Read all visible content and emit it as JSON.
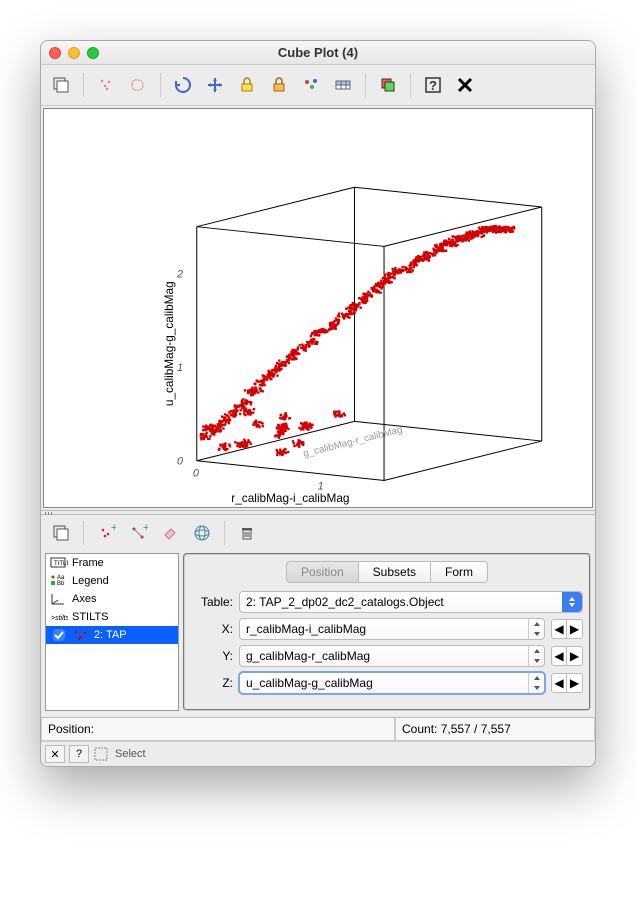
{
  "window": {
    "title": "Cube Plot (4)"
  },
  "toolbar_icons": {
    "export": "export-icon",
    "draw": "draw-subset-icon",
    "blob": "blob-subset-icon",
    "rescale": "rescale-icon",
    "move": "move-icon",
    "lock1": "lock-icon",
    "lock2": "lock2-icon",
    "sketch": "sketch-icon",
    "grid": "grid-icon",
    "layer": "add-layer-icon",
    "help": "help-icon",
    "close": "close-icon"
  },
  "tree": {
    "items": [
      {
        "label": "Frame"
      },
      {
        "label": "Legend"
      },
      {
        "label": "Axes"
      },
      {
        "label": "STILTS"
      },
      {
        "label": "2: TAP",
        "selected": true
      }
    ]
  },
  "tabs": {
    "t0": "Position",
    "t1": "Subsets",
    "t2": "Form",
    "active": 0
  },
  "form": {
    "table_label": "Table:",
    "table_value": "2: TAP_2_dp02_dc2_catalogs.Object",
    "x_label": "X:",
    "x_value": "r_calibMag-i_calibMag",
    "y_label": "Y:",
    "y_value": "g_calibMag-r_calibMag",
    "z_label": "Z:",
    "z_value": "u_calibMag-g_calibMag"
  },
  "status": {
    "position_label": "Position:",
    "count_label": "Count: 7,557 / 7,557"
  },
  "footer": {
    "select_label": "Select"
  },
  "chart_data": {
    "type": "scatter",
    "title": "",
    "axis_labels": {
      "x": "r_calibMag-i_calibMag",
      "y": "g_calibMag-r_calibMag",
      "z": "u_calibMag-g_calibMag"
    },
    "x_range": [
      0,
      1.5
    ],
    "y_range": [
      0,
      1.5
    ],
    "z_range": [
      0,
      2.5
    ],
    "x_ticks": [
      0,
      1
    ],
    "z_ticks": [
      0,
      1,
      2
    ],
    "series": [
      {
        "name": "2: TAP_2_dp02_dc2_catalogs.Object",
        "color": "#d40000",
        "n_points": 7557,
        "note": "dense S-shaped stellar locus from (~0.1, ~0.0, ~0.3) to (~1.4, ~1.3, ~2.3); points below are subsampled"
      }
    ],
    "sample_points_xyz": [
      [
        0.02,
        0.05,
        0.25
      ],
      [
        0.05,
        0.05,
        0.35
      ],
      [
        0.08,
        0.08,
        0.3
      ],
      [
        0.1,
        0.1,
        0.35
      ],
      [
        0.12,
        0.1,
        0.4
      ],
      [
        0.15,
        0.12,
        0.45
      ],
      [
        0.18,
        0.15,
        0.5
      ],
      [
        0.2,
        0.18,
        0.55
      ],
      [
        0.23,
        0.2,
        0.6
      ],
      [
        0.25,
        0.22,
        0.7
      ],
      [
        0.27,
        0.25,
        0.72
      ],
      [
        0.3,
        0.25,
        0.8
      ],
      [
        0.32,
        0.3,
        0.85
      ],
      [
        0.35,
        0.3,
        0.9
      ],
      [
        0.38,
        0.32,
        0.95
      ],
      [
        0.4,
        0.35,
        1.0
      ],
      [
        0.42,
        0.4,
        1.05
      ],
      [
        0.45,
        0.4,
        1.1
      ],
      [
        0.48,
        0.45,
        1.15
      ],
      [
        0.5,
        0.5,
        1.2
      ],
      [
        0.53,
        0.5,
        1.3
      ],
      [
        0.55,
        0.55,
        1.3
      ],
      [
        0.58,
        0.6,
        1.35
      ],
      [
        0.6,
        0.6,
        1.4
      ],
      [
        0.63,
        0.65,
        1.45
      ],
      [
        0.65,
        0.7,
        1.5
      ],
      [
        0.68,
        0.7,
        1.55
      ],
      [
        0.7,
        0.75,
        1.6
      ],
      [
        0.73,
        0.75,
        1.65
      ],
      [
        0.75,
        0.8,
        1.7
      ],
      [
        0.78,
        0.8,
        1.75
      ],
      [
        0.8,
        0.85,
        1.8
      ],
      [
        0.83,
        0.85,
        1.85
      ],
      [
        0.85,
        0.9,
        1.9
      ],
      [
        0.88,
        0.95,
        1.9
      ],
      [
        0.9,
        1.0,
        1.95
      ],
      [
        0.93,
        1.0,
        2.0
      ],
      [
        0.95,
        1.05,
        2.0
      ],
      [
        0.98,
        1.05,
        2.05
      ],
      [
        1.0,
        1.1,
        2.1
      ],
      [
        1.03,
        1.1,
        2.1
      ],
      [
        1.05,
        1.12,
        2.15
      ],
      [
        1.08,
        1.15,
        2.15
      ],
      [
        1.1,
        1.15,
        2.2
      ],
      [
        1.13,
        1.18,
        2.2
      ],
      [
        1.15,
        1.2,
        2.2
      ],
      [
        1.18,
        1.2,
        2.25
      ],
      [
        1.2,
        1.22,
        2.25
      ],
      [
        1.23,
        1.23,
        2.25
      ],
      [
        1.25,
        1.25,
        2.3
      ],
      [
        1.28,
        1.25,
        2.3
      ],
      [
        1.3,
        1.27,
        2.3
      ],
      [
        1.33,
        1.28,
        2.3
      ],
      [
        1.35,
        1.28,
        2.3
      ],
      [
        1.38,
        1.3,
        2.3
      ],
      [
        1.4,
        1.3,
        2.3
      ],
      [
        0.1,
        0.3,
        0.1
      ],
      [
        0.3,
        0.1,
        0.2
      ],
      [
        0.5,
        0.2,
        0.3
      ],
      [
        0.8,
        0.4,
        0.5
      ],
      [
        0.2,
        0.6,
        0.2
      ],
      [
        0.7,
        0.2,
        0.4
      ],
      [
        0.4,
        0.5,
        0.1
      ],
      [
        0.15,
        0.4,
        0.3
      ],
      [
        0.6,
        0.1,
        0.15
      ],
      [
        0.25,
        0.2,
        0.5
      ],
      [
        0.35,
        0.4,
        0.3
      ],
      [
        0.45,
        0.3,
        0.45
      ],
      [
        0.55,
        0.4,
        0.35
      ],
      [
        0.05,
        0.2,
        0.1
      ]
    ]
  }
}
